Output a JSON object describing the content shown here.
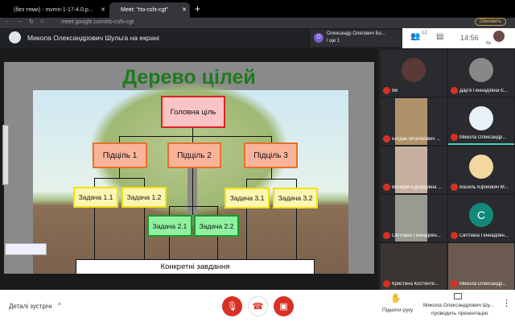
{
  "browser": {
    "tabs": [
      {
        "label": "(без теми) - mvmn-1-17-4.0.p..."
      },
      {
        "label": "Meet: \"rto-csfx-cgt\""
      }
    ],
    "new_tab": "+",
    "url": "meet.google.com/rto-csfx-cgt",
    "update_button": "Обновить"
  },
  "header": {
    "title": "Микола Олександрович Шульга на екрані",
    "notification": {
      "initial": "О",
      "name": "Олександр Олегович Бо...",
      "text": "і ще 1"
    },
    "participants_count": "12",
    "time": "14:56",
    "self_label": "Ви"
  },
  "slide": {
    "title": "Дерево цілей",
    "main_goal": "Головна ціль",
    "subgoals": [
      "Підціль 1",
      "Підціль 2",
      "Підціль 3"
    ],
    "tasks": [
      "Задача 1.1",
      "Задача 1.2",
      "Задача 2.1",
      "Задача 2.2",
      "Задача 3.1",
      "Задача 3.2"
    ],
    "bottom": "Конкретні завдання"
  },
  "participants": [
    {
      "name": "Ви"
    },
    {
      "name": "Дар'я Геннадіївна Є..."
    },
    {
      "name": "Богдан Віталійович ..."
    },
    {
      "name": "Микола Олександр..."
    },
    {
      "name": "Валерія Едуардівна ..."
    },
    {
      "name": "Василь Юрійович М..."
    },
    {
      "name": "Світлана Геннадіївн..."
    },
    {
      "name": "Світлана Геннадіївн...",
      "initial": "С"
    },
    {
      "name": "Кристина Костянти..."
    },
    {
      "name": "Микола Олександр..."
    }
  ],
  "bottom": {
    "details": "Деталі зустрічі",
    "raise_hand": "Підняти руку",
    "presenter": "Микола Олександрович Шу...",
    "presenting": "проводить презентацію"
  },
  "colors": {
    "danger": "#d93025",
    "accent": "#1a73e8",
    "title_green": "#1e7a1e"
  }
}
